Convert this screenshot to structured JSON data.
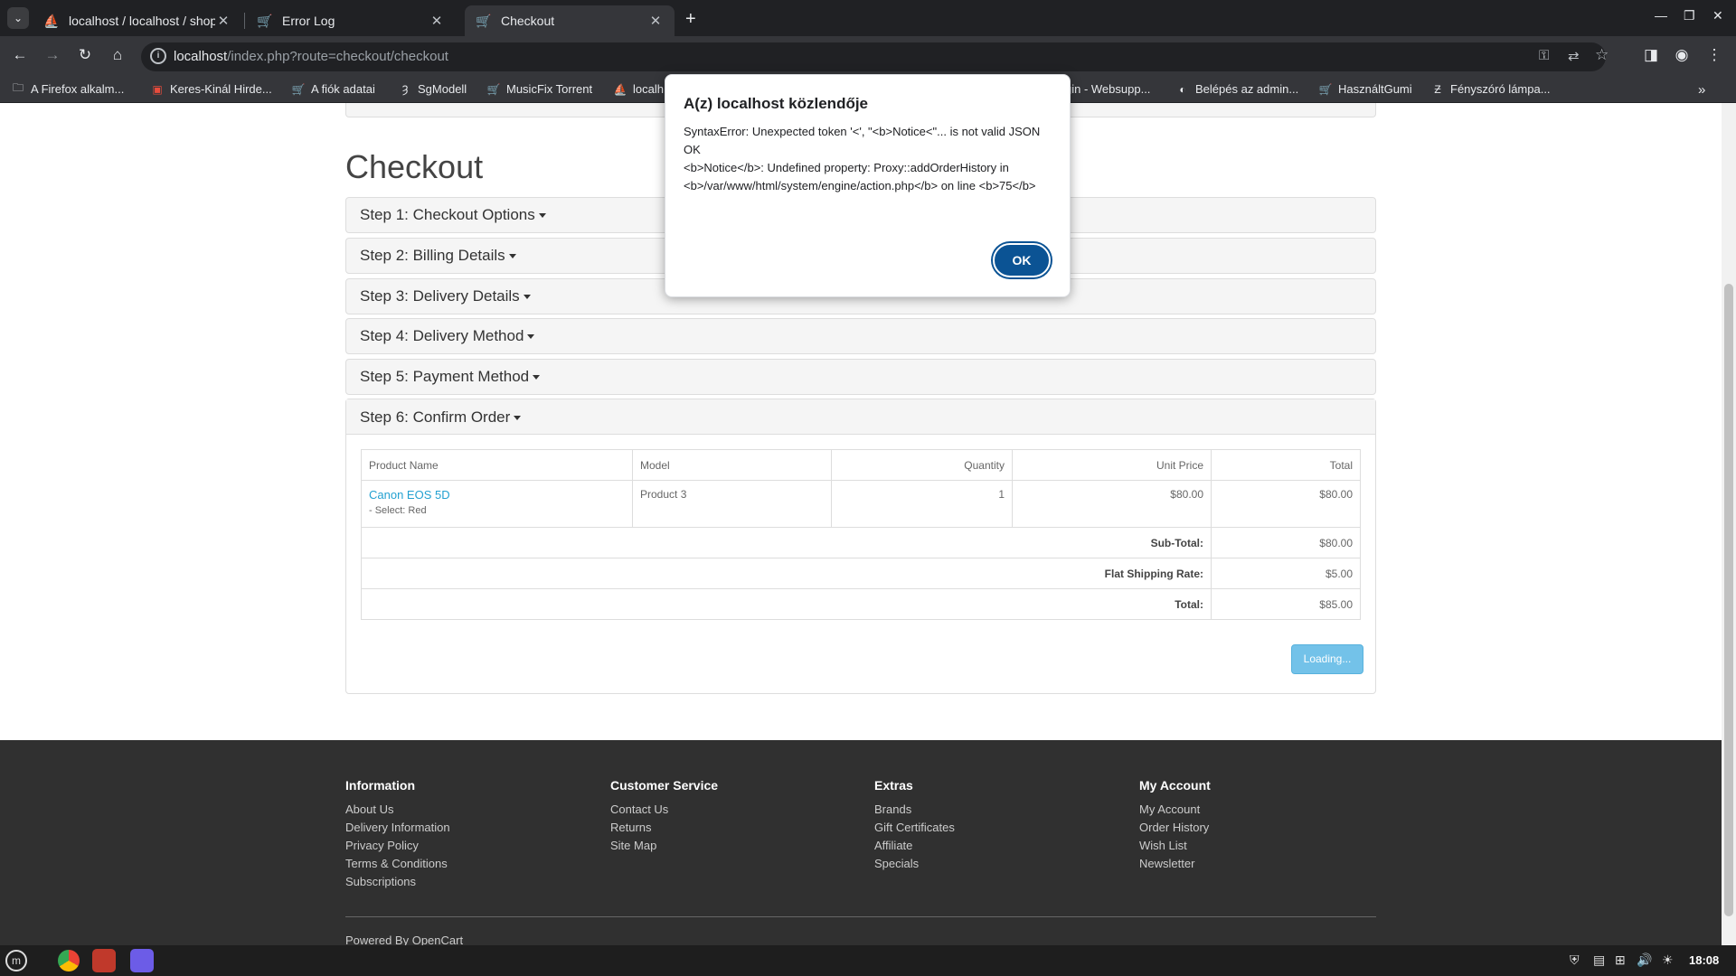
{
  "tabs": [
    {
      "title": "localhost / localhost / shop",
      "icon": "phpmyadmin-icon"
    },
    {
      "title": "Error Log",
      "icon": "cart-icon"
    },
    {
      "title": "Checkout",
      "icon": "cart-icon"
    }
  ],
  "address": {
    "host": "localhost",
    "path": "/index.php?route=checkout/checkout"
  },
  "bookmarks": [
    "A Firefox alkalm...",
    "Keres-Kinál Hirde...",
    "A fiók adatai",
    "SgModell",
    "MusicFix Torrent",
    "localh",
    "gin - Websupp...",
    "Belépés az admin...",
    "HasználtGumi",
    "Fényszóró lámpa..."
  ],
  "page": {
    "title": "Checkout",
    "steps": [
      "Step 1: Checkout Options",
      "Step 2: Billing Details",
      "Step 3: Delivery Details",
      "Step 4: Delivery Method",
      "Step 5: Payment Method",
      "Step 6: Confirm Order"
    ]
  },
  "order": {
    "headers": [
      "Product Name",
      "Model",
      "Quantity",
      "Unit Price",
      "Total"
    ],
    "rows": [
      {
        "name": "Canon EOS 5D",
        "option": "- Select: Red",
        "model": "Product 3",
        "qty": "1",
        "unit": "$80.00",
        "total": "$80.00"
      }
    ],
    "totals": [
      {
        "label": "Sub-Total:",
        "value": "$80.00"
      },
      {
        "label": "Flat Shipping Rate:",
        "value": "$5.00"
      },
      {
        "label": "Total:",
        "value": "$85.00"
      }
    ],
    "button": "Loading..."
  },
  "footer": {
    "columns": [
      {
        "heading": "Information",
        "links": [
          "About Us",
          "Delivery Information",
          "Privacy Policy",
          "Terms & Conditions",
          "Subscriptions"
        ]
      },
      {
        "heading": "Customer Service",
        "links": [
          "Contact Us",
          "Returns",
          "Site Map"
        ]
      },
      {
        "heading": "Extras",
        "links": [
          "Brands",
          "Gift Certificates",
          "Affiliate",
          "Specials"
        ]
      },
      {
        "heading": "My Account",
        "links": [
          "My Account",
          "Order History",
          "Wish List",
          "Newsletter"
        ]
      }
    ],
    "powered_prefix": "Powered By",
    "powered_link": "OpenCart"
  },
  "dialog": {
    "title": "A(z) localhost közlendője",
    "lines": [
      "SyntaxError: Unexpected token '<', \"<b>Notice<\"... is not valid JSON",
      "OK",
      "<b>Notice</b>:  Undefined property: Proxy::addOrderHistory in <b>/var/www/html/system/engine/action.php</b> on line <b>75</b>"
    ],
    "ok": "OK"
  },
  "taskbar": {
    "clock": "18:08"
  }
}
